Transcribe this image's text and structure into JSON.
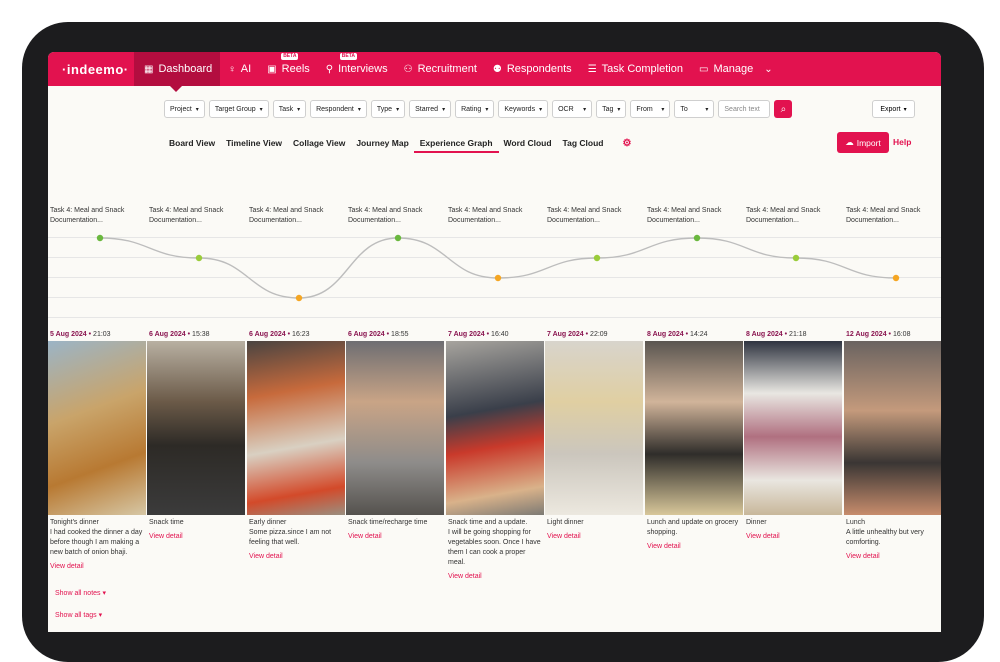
{
  "nav": {
    "logo": "·indeemo·",
    "items": [
      {
        "label": "Dashboard",
        "icon": "dashboard-icon",
        "active": true
      },
      {
        "label": "AI",
        "icon": "lightbulb-icon"
      },
      {
        "label": "Reels",
        "icon": "reel-icon",
        "badge": "BETA"
      },
      {
        "label": "Interviews",
        "icon": "microphone-icon",
        "badge": "BETA"
      },
      {
        "label": "Recruitment",
        "icon": "person-add-icon"
      },
      {
        "label": "Respondents",
        "icon": "people-icon"
      },
      {
        "label": "Task Completion",
        "icon": "list-check-icon"
      },
      {
        "label": "Manage",
        "icon": "briefcase-icon"
      }
    ]
  },
  "filters": {
    "items": [
      "Project",
      "Target Group",
      "Task",
      "Respondent",
      "Type",
      "Starred",
      "Rating",
      "Keywords",
      "OCR",
      "Tag",
      "From",
      "To"
    ],
    "search_placeholder": "Search text",
    "export_label": "Export"
  },
  "views": {
    "tabs": [
      "Board View",
      "Timeline View",
      "Collage View",
      "Journey Map",
      "Experience Graph",
      "Word Cloud",
      "Tag Cloud"
    ],
    "active": "Experience Graph",
    "import_label": "Import",
    "help_label": "Help"
  },
  "graph": {
    "task_label": "Task 4: Meal and Snack Documentation...",
    "levels": [
      4,
      3,
      1,
      4,
      2,
      3,
      4,
      3,
      2
    ],
    "colors": {
      "good": "#6ab83e",
      "neutral": "#9acc3a",
      "bad": "#f5a623"
    }
  },
  "entries": [
    {
      "date": "5 Aug 2024",
      "time": "21:03",
      "title": "Tonight's dinner",
      "note": "I had cooked the dinner a day before though I am making a new batch of onion bhaji.",
      "link": "View detail"
    },
    {
      "date": "6 Aug 2024",
      "time": "15:38",
      "title": "Snack time",
      "note": "",
      "link": "View detail"
    },
    {
      "date": "6 Aug 2024",
      "time": "16:23",
      "title": "Early dinner",
      "note": "Some pizza.since I am not feeling that well.",
      "link": "View detail"
    },
    {
      "date": "6 Aug 2024",
      "time": "18:55",
      "title": "Snack time/recharge time",
      "note": "",
      "link": "View detail"
    },
    {
      "date": "7 Aug 2024",
      "time": "16:40",
      "title": "Snack time and a update.",
      "note": "I will be going shopping for vegetables soon. Once I have them I can cook a proper meal.",
      "link": "View detail"
    },
    {
      "date": "7 Aug 2024",
      "time": "22:09",
      "title": "Light dinner",
      "note": "",
      "link": "View detail"
    },
    {
      "date": "8 Aug 2024",
      "time": "14:24",
      "title": "Lunch and update on grocery shopping.",
      "note": "",
      "link": "View detail"
    },
    {
      "date": "8 Aug 2024",
      "time": "21:18",
      "title": "Dinner",
      "note": "",
      "link": "View detail"
    },
    {
      "date": "12 Aug 2024",
      "time": "16:08",
      "title": "Lunch",
      "note": "A little unhealthy but very comforting.",
      "link": "View detail"
    }
  ],
  "extras": {
    "show_notes": "Show all notes",
    "show_tags": "Show all tags"
  }
}
